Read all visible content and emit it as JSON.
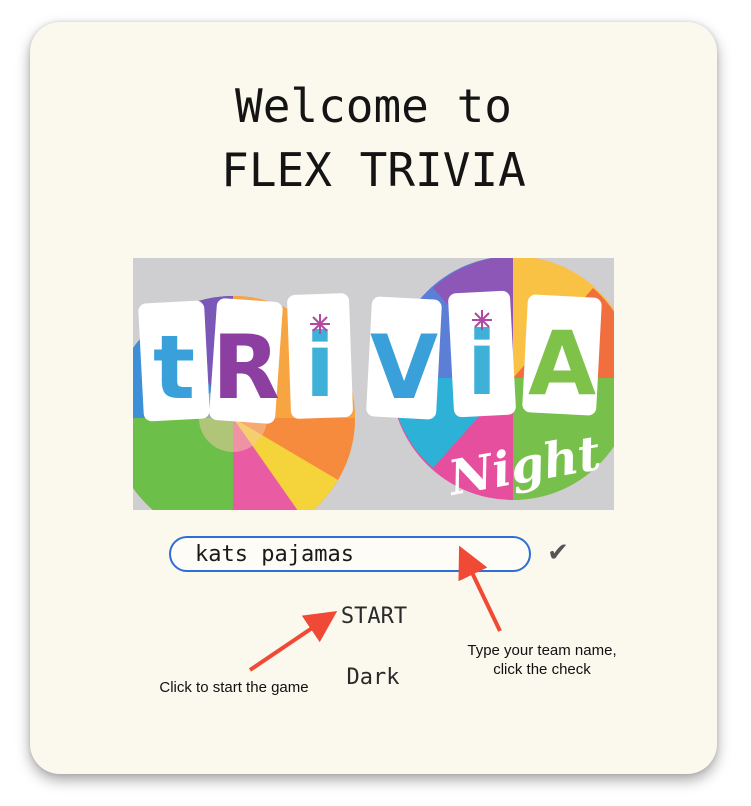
{
  "title": {
    "line1": "Welcome to",
    "line2": "FLEX TRIVIA"
  },
  "banner": {
    "word": "TRiViA",
    "subword": "Night",
    "letters": [
      "t",
      "R",
      "i",
      "V",
      "i",
      "A"
    ],
    "letter_colors": [
      "#3aa0da",
      "#8c3fa0",
      "#3fb0d8",
      "#3aa0da",
      "#3fb0d8",
      "#7ec24a"
    ]
  },
  "team_input": {
    "value": "kats pajamas",
    "placeholder": ""
  },
  "check_icon": "check-icon",
  "start_label": "START",
  "dark_label": "Dark",
  "annotations": {
    "team_hint_line1": "Type your team name,",
    "team_hint_line2": "click the check",
    "start_hint": "Click to start the game"
  },
  "colors": {
    "card_background": "#fbf8ee",
    "input_border": "#2d6fd6",
    "arrow": "#f04a37"
  }
}
